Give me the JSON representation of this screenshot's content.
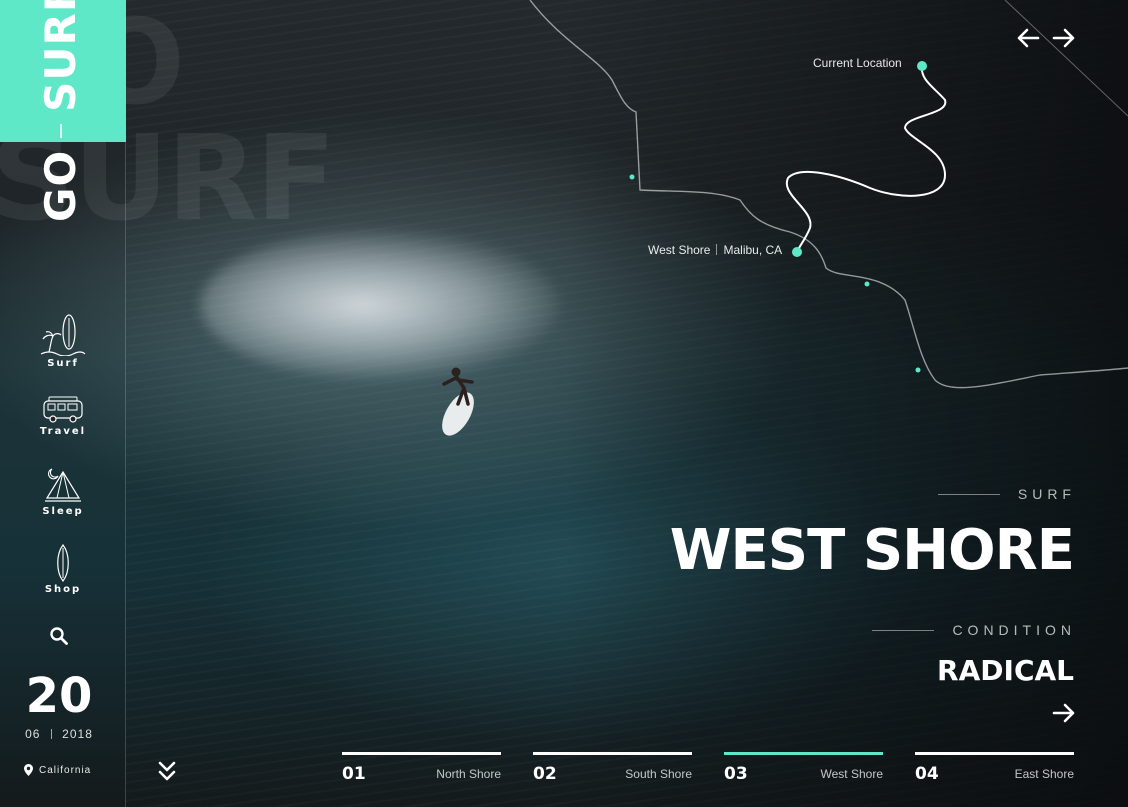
{
  "brand": {
    "logo_part1": "GO",
    "logo_part2": "SURF",
    "ghost_line1": "GO",
    "ghost_line2": "SURF",
    "accent_color": "#5fe8c8"
  },
  "sidebar": {
    "items": [
      {
        "label": "Surf",
        "icon": "surfboard-palm-icon"
      },
      {
        "label": "Travel",
        "icon": "van-icon"
      },
      {
        "label": "Sleep",
        "icon": "tent-moon-icon"
      },
      {
        "label": "Shop",
        "icon": "surfboard-icon"
      }
    ],
    "search_icon": "search-icon",
    "date_day": "20",
    "date_month": "06",
    "date_year": "2018",
    "location": "California"
  },
  "nav": {
    "prev_icon": "arrow-left-icon",
    "next_icon": "arrow-right-icon"
  },
  "map": {
    "current_location_label": "Current Location",
    "spot_name": "West Shore",
    "spot_region": "Malibu, CA"
  },
  "hero": {
    "category": "SURF",
    "title": "WEST SHORE",
    "condition_label": "CONDITION",
    "condition_value": "RADICAL"
  },
  "tabs": [
    {
      "num": "01",
      "name": "North Shore",
      "active": false
    },
    {
      "num": "02",
      "name": "South Shore",
      "active": false
    },
    {
      "num": "03",
      "name": "West Shore",
      "active": true
    },
    {
      "num": "04",
      "name": "East Shore",
      "active": false
    }
  ]
}
